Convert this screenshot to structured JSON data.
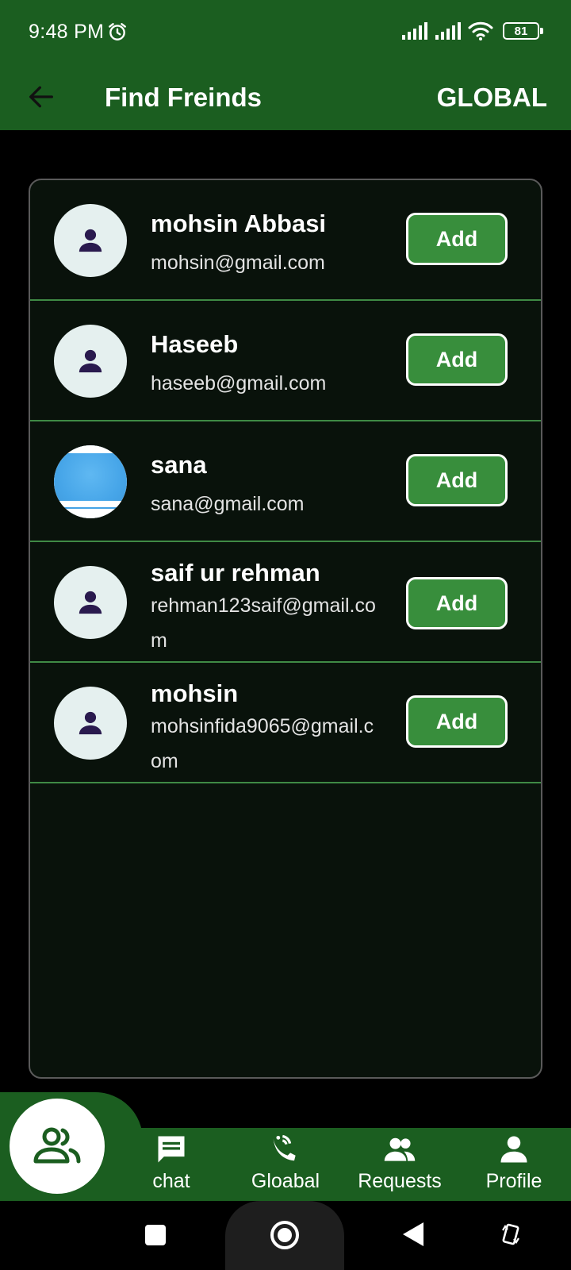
{
  "status_bar": {
    "time": "9:48 PM",
    "battery": "81",
    "icons": [
      "alarm-icon",
      "signal-icon",
      "signal-icon",
      "wifi-icon",
      "battery-icon"
    ]
  },
  "app_bar": {
    "back_icon": "arrow-left-icon",
    "title": "Find Freinds",
    "action": "GLOBAL"
  },
  "users": [
    {
      "name": "mohsin Abbasi",
      "email": "mohsin@gmail.com",
      "avatar": "person-icon",
      "button": "Add"
    },
    {
      "name": "Haseeb",
      "email": "haseeb@gmail.com",
      "avatar": "person-icon",
      "button": "Add"
    },
    {
      "name": "sana",
      "email": "sana@gmail.com",
      "avatar": "photo",
      "button": "Add"
    },
    {
      "name": "saif ur rehman",
      "email": "rehman123saif@gmail.com",
      "avatar": "person-icon",
      "button": "Add"
    },
    {
      "name": "mohsin",
      "email": "mohsinfida9065@gmail.com",
      "avatar": "person-icon",
      "button": "Add"
    }
  ],
  "bottom_nav": {
    "fab_icon": "group-icon",
    "items": [
      {
        "label": "chat",
        "icon": "chat-icon"
      },
      {
        "label": "Gloabal",
        "icon": "wifi-calling-icon"
      },
      {
        "label": "Requests",
        "icon": "people-icon"
      },
      {
        "label": "Profile",
        "icon": "person-icon"
      }
    ]
  },
  "colors": {
    "primary": "#1b5e20",
    "button": "#388e3c",
    "card_background": "#09120b",
    "divider": "#3f8a45",
    "avatar_background": "#e5f0ef",
    "person_icon": "#2a1a4e"
  }
}
